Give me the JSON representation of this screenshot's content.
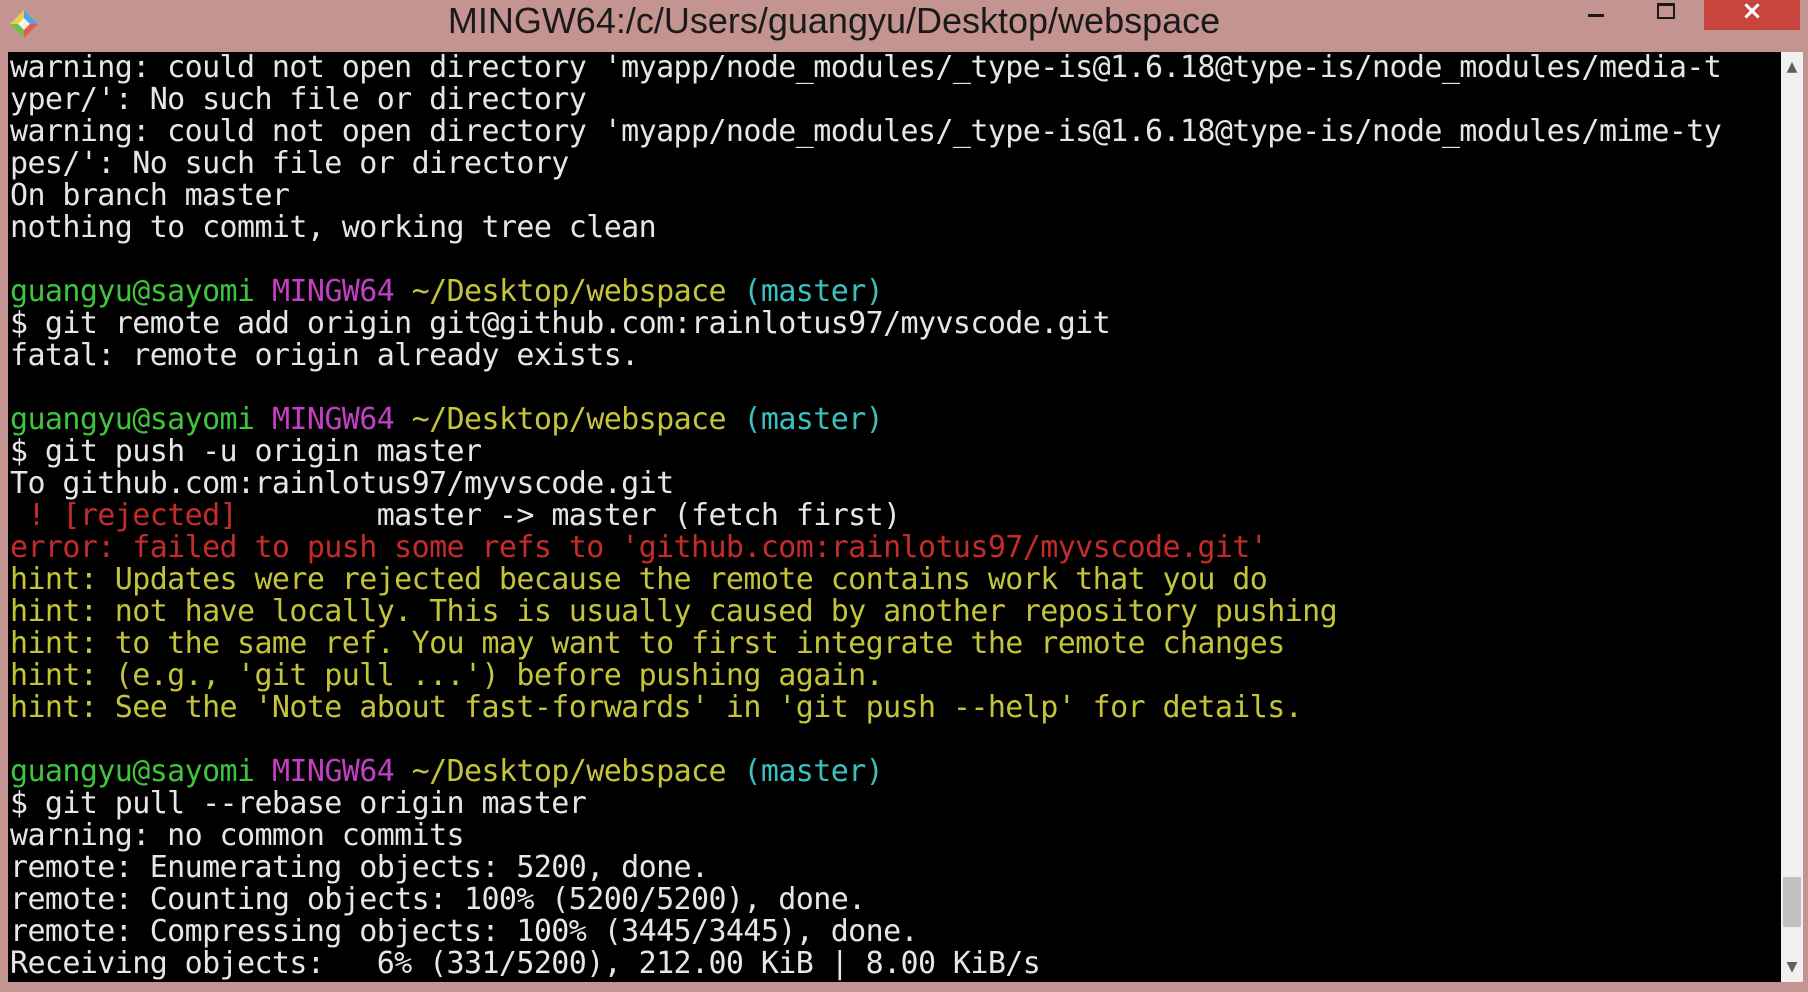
{
  "window": {
    "title": "MINGW64:/c/Users/guangyu/Desktop/webspace",
    "buttons": {
      "minimize": "minimize",
      "maximize": "maximize",
      "close": "×"
    }
  },
  "colors": {
    "titlebar": "#c49490",
    "close": "#c7453d",
    "background": "#000000",
    "text": "#e6e6e6",
    "green": "#3fc43f",
    "magenta": "#c33ec3",
    "yellow": "#c4c43c",
    "cyan": "#3cbfbf",
    "red": "#c42b2b"
  },
  "terminal": {
    "lines": [
      [
        {
          "t": "warning: could not open directory 'myapp/node_modules/_type-is@1.6.18@type-is/node_modules/media-t",
          "c": "white"
        }
      ],
      [
        {
          "t": "yper/': No such file or directory",
          "c": "white"
        }
      ],
      [
        {
          "t": "warning: could not open directory 'myapp/node_modules/_type-is@1.6.18@type-is/node_modules/mime-ty",
          "c": "white"
        }
      ],
      [
        {
          "t": "pes/': No such file or directory",
          "c": "white"
        }
      ],
      [
        {
          "t": "On branch master",
          "c": "white"
        }
      ],
      [
        {
          "t": "nothing to commit, working tree clean",
          "c": "white"
        }
      ],
      [
        {
          "t": "",
          "c": "white"
        }
      ],
      [
        {
          "t": "guangyu@sayomi ",
          "c": "green"
        },
        {
          "t": "MINGW64 ",
          "c": "magenta"
        },
        {
          "t": "~/Desktop/webspace ",
          "c": "yellow"
        },
        {
          "t": "(master)",
          "c": "cyan"
        }
      ],
      [
        {
          "t": "$ git remote add origin git@github.com:rainlotus97/myvscode.git",
          "c": "white"
        }
      ],
      [
        {
          "t": "fatal: remote origin already exists.",
          "c": "white"
        }
      ],
      [
        {
          "t": "",
          "c": "white"
        }
      ],
      [
        {
          "t": "guangyu@sayomi ",
          "c": "green"
        },
        {
          "t": "MINGW64 ",
          "c": "magenta"
        },
        {
          "t": "~/Desktop/webspace ",
          "c": "yellow"
        },
        {
          "t": "(master)",
          "c": "cyan"
        }
      ],
      [
        {
          "t": "$ git push -u origin master",
          "c": "white"
        }
      ],
      [
        {
          "t": "To github.com:rainlotus97/myvscode.git",
          "c": "white"
        }
      ],
      [
        {
          "t": " ! [rejected]        ",
          "c": "red"
        },
        {
          "t": "master -> master (fetch first)",
          "c": "white"
        }
      ],
      [
        {
          "t": "error: failed to push some refs to 'github.com:rainlotus97/myvscode.git'",
          "c": "red"
        }
      ],
      [
        {
          "t": "hint: Updates were rejected because the remote contains work that you do",
          "c": "yellow"
        }
      ],
      [
        {
          "t": "hint: not have locally. This is usually caused by another repository pushing",
          "c": "yellow"
        }
      ],
      [
        {
          "t": "hint: to the same ref. You may want to first integrate the remote changes",
          "c": "yellow"
        }
      ],
      [
        {
          "t": "hint: (e.g., 'git pull ...') before pushing again.",
          "c": "yellow"
        }
      ],
      [
        {
          "t": "hint: See the 'Note about fast-forwards' in 'git push --help' for details.",
          "c": "yellow"
        }
      ],
      [
        {
          "t": "",
          "c": "white"
        }
      ],
      [
        {
          "t": "guangyu@sayomi ",
          "c": "green"
        },
        {
          "t": "MINGW64 ",
          "c": "magenta"
        },
        {
          "t": "~/Desktop/webspace ",
          "c": "yellow"
        },
        {
          "t": "(master)",
          "c": "cyan"
        }
      ],
      [
        {
          "t": "$ git pull --rebase origin master",
          "c": "white"
        }
      ],
      [
        {
          "t": "warning: no common commits",
          "c": "white"
        }
      ],
      [
        {
          "t": "remote: Enumerating objects: 5200, done.",
          "c": "white"
        }
      ],
      [
        {
          "t": "remote: Counting objects: 100% (5200/5200), done.",
          "c": "white"
        }
      ],
      [
        {
          "t": "remote: Compressing objects: 100% (3445/3445), done.",
          "c": "white"
        }
      ],
      [
        {
          "t": "Receiving objects:   6% (331/5200), 212.00 KiB | 8.00 KiB/s",
          "c": "white"
        }
      ]
    ]
  },
  "scrollbar": {
    "up_icon": "▲",
    "down_icon": "▼",
    "position": 0.97
  }
}
